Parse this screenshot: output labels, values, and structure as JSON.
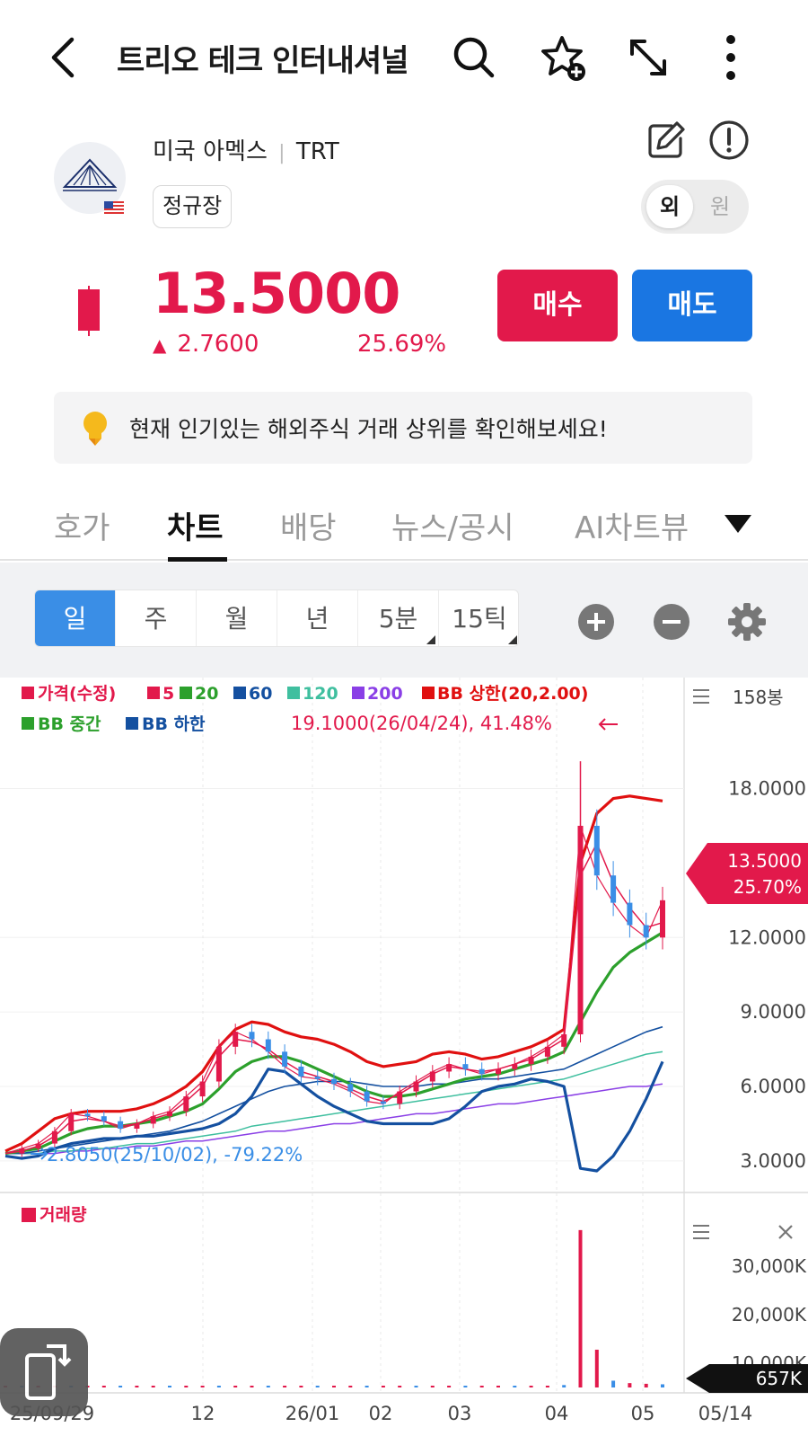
{
  "header": {
    "title": "트리오 테크 인터내셔널"
  },
  "stock": {
    "market": "미국 아멕스",
    "ticker": "TRT",
    "session": "정규장",
    "toggle_foreign": "외",
    "toggle_won": "원",
    "price": "13.5000",
    "change": "2.7600",
    "change_pct": "25.69%",
    "color_up": "#e2194b",
    "color_down": "#1a76e2"
  },
  "actions": {
    "buy": "매수",
    "sell": "매도"
  },
  "banner": {
    "text": "현재 인기있는 해외주식 거래 상위를 확인해보세요!"
  },
  "tabs": [
    {
      "label": "호가"
    },
    {
      "label": "차트",
      "active": true
    },
    {
      "label": "배당"
    },
    {
      "label": "뉴스/공시"
    },
    {
      "label": "AI차트뷰"
    }
  ],
  "periods": [
    {
      "label": "일",
      "active": true
    },
    {
      "label": "주"
    },
    {
      "label": "월"
    },
    {
      "label": "년"
    },
    {
      "label": "5분"
    },
    {
      "label": "15틱"
    }
  ],
  "chart_data": {
    "type": "line",
    "legend_row1": [
      "가격(수정)",
      "5",
      "20",
      "60",
      "120",
      "200",
      "BB 상한(20,2.00)"
    ],
    "legend_row2": [
      "BB 중간",
      "BB 하한"
    ],
    "bars_label": "158봉",
    "max_annotation": "19.1000(26/04/24), 41.48%",
    "min_annotation": "2.8050(25/10/02), -79.22%",
    "current_tag_price": "13.5000",
    "current_tag_pct": "25.70%",
    "y_ticks": [
      "18.0000",
      "12.0000",
      "9.0000",
      "6.0000",
      "3.0000"
    ],
    "y_tick_values": [
      18,
      12,
      9,
      6,
      3
    ],
    "ylim": [
      2.2,
      20.3
    ],
    "x_labels": [
      "25/09/29",
      "12",
      "26/01",
      "02",
      "03",
      "04",
      "05",
      "05/14"
    ],
    "volume_title": "거래량",
    "volume_ticks": [
      "30,000K",
      "20,000K",
      "10,000K"
    ],
    "volume_current": "657K",
    "legend_colors": [
      "#e2194b",
      "#e2194b",
      "#2ca02c",
      "#1450a0",
      "#3fbf9f",
      "#8a3fe6",
      "#e01010",
      "#2ca02c",
      "#1450a0"
    ],
    "series": [
      {
        "name": "가격(수정)",
        "values": [
          3.3,
          3.5,
          3.7,
          4.2,
          4.9,
          4.8,
          4.6,
          4.3,
          4.5,
          4.8,
          5.0,
          5.6,
          6.2,
          7.6,
          8.2,
          7.9,
          7.4,
          6.8,
          6.4,
          6.3,
          6.1,
          5.8,
          5.4,
          5.3,
          5.8,
          6.2,
          6.6,
          6.9,
          6.7,
          6.5,
          6.7,
          6.9,
          7.2,
          7.6,
          8.1,
          16.5,
          14.5,
          13.4,
          12.5,
          12.0,
          13.5
        ]
      },
      {
        "name": "5",
        "values": [
          3.3,
          3.4,
          3.6,
          4.0,
          4.6,
          4.7,
          4.6,
          4.4,
          4.5,
          4.7,
          4.9,
          5.4,
          6.0,
          7.2,
          7.9,
          7.8,
          7.5,
          7.0,
          6.6,
          6.4,
          6.2,
          5.9,
          5.6,
          5.4,
          5.7,
          6.1,
          6.5,
          6.8,
          6.7,
          6.6,
          6.7,
          6.9,
          7.1,
          7.5,
          7.9,
          14.5,
          15.8,
          14.2,
          13.2,
          12.4,
          12.6
        ]
      },
      {
        "name": "20",
        "values": [
          3.3,
          3.4,
          3.5,
          3.8,
          4.1,
          4.3,
          4.4,
          4.4,
          4.5,
          4.6,
          4.8,
          5.0,
          5.3,
          5.9,
          6.6,
          7.0,
          7.2,
          7.2,
          7.0,
          6.7,
          6.4,
          6.1,
          5.8,
          5.6,
          5.6,
          5.7,
          5.9,
          6.1,
          6.3,
          6.4,
          6.5,
          6.7,
          6.9,
          7.1,
          7.4,
          8.6,
          9.8,
          10.8,
          11.4,
          11.8,
          12.2
        ]
      },
      {
        "name": "60",
        "values": [
          3.3,
          3.3,
          3.4,
          3.5,
          3.6,
          3.7,
          3.8,
          3.9,
          4.0,
          4.1,
          4.2,
          4.4,
          4.6,
          4.9,
          5.2,
          5.5,
          5.8,
          6.0,
          6.1,
          6.2,
          6.2,
          6.2,
          6.1,
          6.0,
          6.0,
          6.0,
          6.1,
          6.1,
          6.2,
          6.3,
          6.3,
          6.4,
          6.5,
          6.6,
          6.7,
          7.0,
          7.3,
          7.6,
          7.9,
          8.2,
          8.4
        ]
      },
      {
        "name": "120",
        "values": [
          3.3,
          3.3,
          3.3,
          3.4,
          3.4,
          3.5,
          3.5,
          3.6,
          3.7,
          3.7,
          3.8,
          3.9,
          4.0,
          4.1,
          4.2,
          4.4,
          4.5,
          4.6,
          4.7,
          4.8,
          4.9,
          5.0,
          5.1,
          5.2,
          5.3,
          5.4,
          5.5,
          5.6,
          5.7,
          5.8,
          5.9,
          6.0,
          6.1,
          6.2,
          6.3,
          6.5,
          6.7,
          6.9,
          7.1,
          7.3,
          7.4
        ]
      },
      {
        "name": "200",
        "values": [
          3.3,
          3.3,
          3.3,
          3.3,
          3.4,
          3.4,
          3.5,
          3.5,
          3.6,
          3.6,
          3.7,
          3.8,
          3.8,
          3.9,
          4.0,
          4.1,
          4.2,
          4.2,
          4.3,
          4.4,
          4.5,
          4.5,
          4.6,
          4.7,
          4.8,
          4.9,
          4.9,
          5.0,
          5.1,
          5.2,
          5.3,
          5.3,
          5.4,
          5.5,
          5.6,
          5.7,
          5.8,
          5.9,
          6.0,
          6.0,
          6.1
        ]
      },
      {
        "name": "BB 상한",
        "values": [
          3.4,
          3.7,
          4.2,
          4.7,
          4.9,
          5.0,
          5.0,
          5.0,
          5.1,
          5.3,
          5.6,
          6.0,
          6.6,
          7.6,
          8.3,
          8.6,
          8.5,
          8.2,
          8.0,
          7.9,
          7.7,
          7.4,
          7.0,
          6.8,
          6.9,
          7.0,
          7.3,
          7.4,
          7.3,
          7.1,
          7.2,
          7.4,
          7.6,
          7.9,
          8.3,
          15.0,
          17.0,
          17.6,
          17.7,
          17.6,
          17.5
        ]
      },
      {
        "name": "BB 중간",
        "values": [
          3.3,
          3.4,
          3.5,
          3.8,
          4.1,
          4.3,
          4.4,
          4.4,
          4.5,
          4.6,
          4.8,
          5.0,
          5.3,
          5.9,
          6.6,
          7.0,
          7.2,
          7.2,
          7.0,
          6.7,
          6.4,
          6.1,
          5.8,
          5.6,
          5.6,
          5.7,
          5.9,
          6.1,
          6.3,
          6.4,
          6.5,
          6.7,
          6.9,
          7.1,
          7.4,
          8.6,
          9.8,
          10.8,
          11.4,
          11.8,
          12.2
        ]
      },
      {
        "name": "BB 하한",
        "values": [
          3.2,
          3.1,
          3.2,
          3.5,
          3.7,
          3.8,
          3.9,
          3.9,
          4.0,
          4.0,
          4.1,
          4.2,
          4.3,
          4.5,
          4.9,
          5.6,
          6.7,
          6.6,
          6.1,
          5.6,
          5.2,
          4.9,
          4.6,
          4.5,
          4.5,
          4.5,
          4.5,
          4.7,
          5.2,
          5.8,
          6.0,
          6.1,
          6.3,
          6.2,
          6.0,
          2.7,
          2.6,
          3.2,
          4.2,
          5.5,
          7.0
        ]
      }
    ],
    "volume": [
      60,
      80,
      70,
      90,
      110,
      95,
      85,
      70,
      65,
      90,
      100,
      140,
      180,
      260,
      220,
      160,
      130,
      120,
      110,
      100,
      95,
      90,
      80,
      85,
      120,
      110,
      100,
      95,
      90,
      100,
      110,
      130,
      160,
      210,
      500,
      32500,
      7800,
      1400,
      900,
      760,
      657
    ]
  }
}
